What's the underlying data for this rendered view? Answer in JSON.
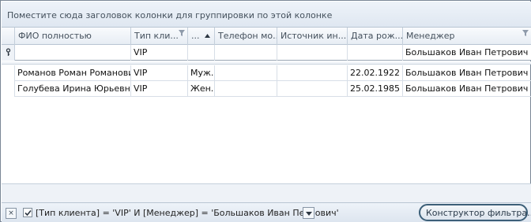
{
  "group_panel": {
    "hint": "Поместите сюда заголовок колонки для группировки по этой колонке"
  },
  "columns": [
    {
      "label": "ФИО полностью",
      "filter": false,
      "sort": false
    },
    {
      "label": "Тип клиента",
      "display": "Тип кли...",
      "filter": true,
      "sort": false
    },
    {
      "label": "...",
      "display": "...",
      "filter": false,
      "sort": "ascending"
    },
    {
      "label": "Телефон мобильный",
      "display": "Телефон мо...",
      "filter": false,
      "sort": false
    },
    {
      "label": "Источник информации",
      "display": "Источник ин...",
      "filter": false,
      "sort": false
    },
    {
      "label": "Дата рождения",
      "display": "Дата рож...",
      "filter": false,
      "sort": false
    },
    {
      "label": "Менеджер",
      "display": "Менеджер",
      "filter": true,
      "sort": false
    }
  ],
  "auto_filter_row": {
    "indicator_icon": "key-filter-icon",
    "values": [
      "",
      "VIP",
      "",
      "",
      "",
      "",
      "Большаков Иван Петрович"
    ]
  },
  "rows": [
    [
      "Романов Роман Романович",
      "VIP",
      "Муж.",
      "",
      "",
      "22.02.1922",
      "Большаков Иван Петрович"
    ],
    [
      "Голубева Ирина Юрьевна",
      "VIP",
      "Жен.",
      "",
      "",
      "25.02.1985",
      "Большаков Иван Петрович"
    ]
  ],
  "filter_panel": {
    "close_label": "×",
    "enabled": true,
    "expression": "[Тип клиента] = 'VIP' И [Менеджер] = 'Большаков Иван Петрович'",
    "builder_label": "Конструктор фильтра..."
  },
  "colors": {
    "border": "#7a8796",
    "panel_bg": "#e4ebf4",
    "highlight": "#3c5f78"
  }
}
